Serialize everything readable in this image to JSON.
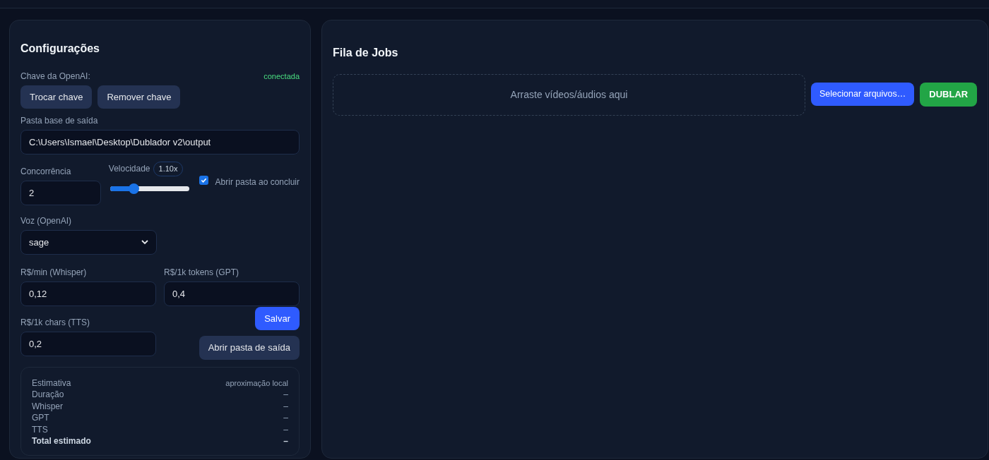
{
  "settings": {
    "title": "Configurações",
    "api_key": {
      "label": "Chave da OpenAI:",
      "status": "conectada",
      "buttons": [
        "Trocar chave",
        "Remover chave"
      ]
    },
    "output_folder": {
      "label": "Pasta base de saída",
      "value": "C:\\Users\\Ismael\\Desktop\\Dublador v2\\output"
    },
    "concurrency": {
      "label": "Concorrência",
      "value": "2"
    },
    "speed": {
      "label": "Velocidade",
      "reading": "1.10x",
      "level": 0.3
    },
    "open_folder_checkbox": {
      "label": "Abrir pasta ao concluir",
      "checked": true
    },
    "voice": {
      "label": "Voz (OpenAI)",
      "value": "sage"
    },
    "prices": [
      {
        "label": "R$/min (Whisper)",
        "value": "0,12"
      },
      {
        "label": "R$/1k tokens (GPT)",
        "value": "0,4"
      },
      {
        "label": "R$/1k chars (TTS)",
        "value": "0,2"
      }
    ],
    "save_button": "Salvar",
    "open_output_button": "Abrir pasta de saída",
    "estimate": {
      "title": "Estimativa",
      "note": "aproximação local",
      "rows": [
        {
          "label": "Duração",
          "value": "–",
          "kind": "normal"
        },
        {
          "label": "Whisper",
          "value": "–",
          "kind": "normal"
        },
        {
          "label": "GPT",
          "value": "–",
          "kind": "normal"
        },
        {
          "label": "TTS",
          "value": "–",
          "kind": "normal"
        },
        {
          "label": "Total estimado",
          "value": "–",
          "kind": "total"
        }
      ]
    }
  },
  "queue": {
    "title": "Fila de Jobs",
    "dropzone": "Arraste vídeos/áudios aqui",
    "select_button": "Selecionar arquivos…",
    "dub_button": "DUBLAR"
  }
}
